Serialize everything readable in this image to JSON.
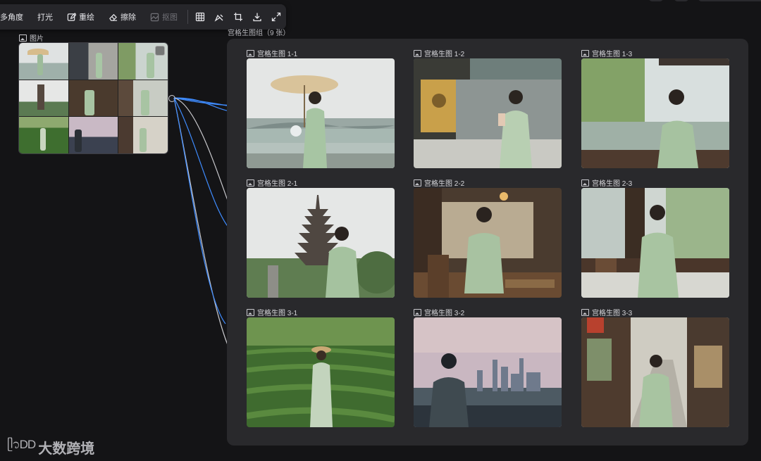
{
  "toolbar": {
    "items": [
      {
        "label": "多角度",
        "icon": "multi-angle-icon",
        "disabled": false
      },
      {
        "label": "打光",
        "icon": "lighting-icon",
        "disabled": false
      },
      {
        "label": "重绘",
        "icon": "redraw-icon",
        "disabled": false
      },
      {
        "label": "擦除",
        "icon": "eraser-icon",
        "disabled": false
      },
      {
        "label": "抠图",
        "icon": "cutout-icon",
        "disabled": true
      }
    ],
    "icon_buttons": [
      "grid-icon",
      "brush-icon",
      "crop-icon",
      "download-icon",
      "fullscreen-icon"
    ]
  },
  "source_node": {
    "label": "图片",
    "icon": "image-icon"
  },
  "group": {
    "title": "宫格生图组（9 张）",
    "tiles": [
      {
        "label": "宫格生图 1-1",
        "scene": "umbrella-lake"
      },
      {
        "label": "宫格生图 1-2",
        "scene": "temple-prayer"
      },
      {
        "label": "宫格生图 1-3",
        "scene": "reeds-railing"
      },
      {
        "label": "宫格生图 2-1",
        "scene": "pagoda"
      },
      {
        "label": "宫格生图 2-2",
        "scene": "tea-house"
      },
      {
        "label": "宫格生图 2-3",
        "scene": "willow-window"
      },
      {
        "label": "宫格生图 3-1",
        "scene": "tea-field"
      },
      {
        "label": "宫格生图 3-2",
        "scene": "city-skyline"
      },
      {
        "label": "宫格生图 3-3",
        "scene": "old-street"
      }
    ]
  },
  "watermark": {
    "logo": "ᥫ᭡DD",
    "text": "大数跨境"
  },
  "colors": {
    "background": "#141416",
    "panel": "#29292c",
    "wire_active": "#3f8cff",
    "wire_idle": "#c8c8cc"
  }
}
